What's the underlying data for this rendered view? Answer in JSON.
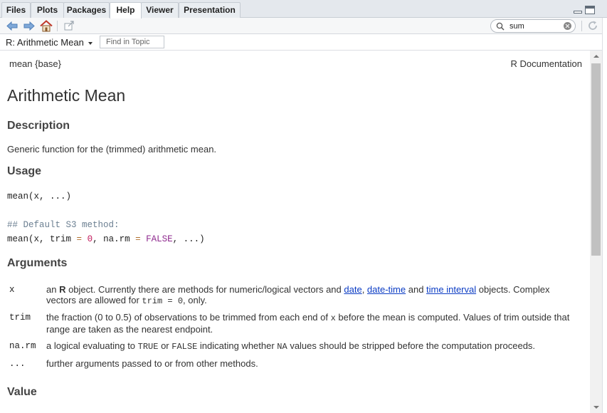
{
  "tabs": [
    {
      "label": "Files",
      "active": false
    },
    {
      "label": "Plots",
      "active": false
    },
    {
      "label": "Packages",
      "active": false
    },
    {
      "label": "Help",
      "active": true
    },
    {
      "label": "Viewer",
      "active": false
    },
    {
      "label": "Presentation",
      "active": false
    }
  ],
  "toolbar": {
    "icons": [
      "back-arrow-icon",
      "forward-arrow-icon",
      "home-icon",
      "popout-icon"
    ],
    "search_value": "sum",
    "refresh_icon": "refresh-icon"
  },
  "topicbar": {
    "topic": "R: Arithmetic Mean",
    "find_placeholder": "Find in Topic"
  },
  "doc": {
    "header_left": "mean {base}",
    "header_right": "R Documentation",
    "title": "Arithmetic Mean",
    "description_heading": "Description",
    "description_text": "Generic function for the (trimmed) arithmetic mean.",
    "usage_heading": "Usage",
    "usage_line1_a": "mean(x, ...)",
    "usage_comment": "## Default S3 method:",
    "usage_line2": {
      "p1": "mean(x, trim ",
      "eq1": "=",
      "p2": " ",
      "zero": "0",
      "p3": ", na.rm ",
      "eq2": "=",
      "p4": " ",
      "false": "FALSE",
      "p5": ", ...)"
    },
    "arguments_heading": "Arguments",
    "args": {
      "x_name": "x",
      "x_desc_1": "an ",
      "x_desc_R": "R",
      "x_desc_2": " object. Currently there are methods for numeric/logical vectors and ",
      "x_link_date": "date",
      "x_desc_3": ", ",
      "x_link_datetime": "date-time",
      "x_desc_4": " and ",
      "x_link_interval": "time interval",
      "x_desc_5": " objects. Complex vectors are allowed for ",
      "x_code": "trim = 0",
      "x_desc_6": ", only.",
      "trim_name": "trim",
      "trim_desc_1": "the fraction (0 to 0.5) of observations to be trimmed from each end of ",
      "trim_code": "x",
      "trim_desc_2": " before the mean is computed. Values of trim outside that range are taken as the nearest endpoint.",
      "narm_name": "na.rm",
      "narm_desc_1": "a logical evaluating to ",
      "narm_true": "TRUE",
      "narm_desc_2": " or ",
      "narm_false": "FALSE",
      "narm_desc_3": " indicating whether ",
      "narm_na": "NA",
      "narm_desc_4": " values should be stripped before the computation proceeds.",
      "dots_name": "...",
      "dots_desc": "further arguments passed to or from other methods."
    },
    "value_heading": "Value"
  }
}
